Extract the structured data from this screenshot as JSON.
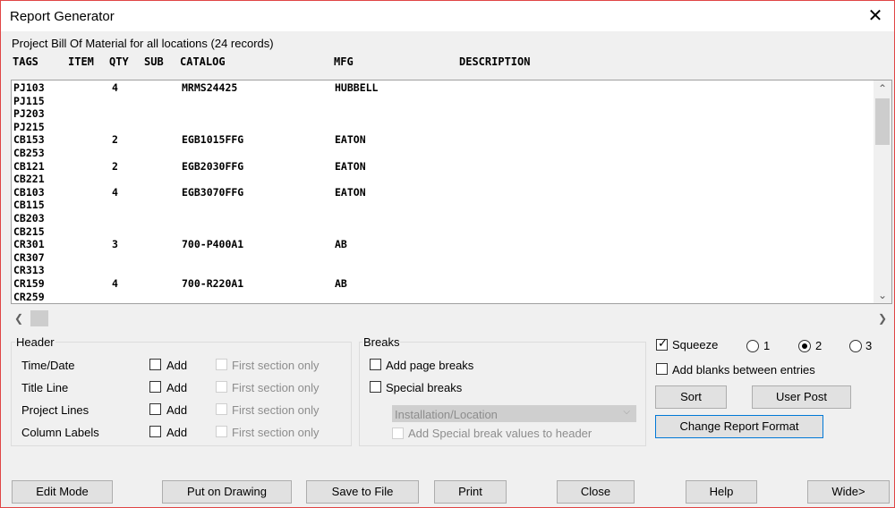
{
  "window": {
    "title": "Report Generator",
    "close_glyph": "✕"
  },
  "summary": "Project Bill Of Material for all locations (24 records)",
  "columns": [
    "TAGS",
    "ITEM",
    "QTY",
    "SUB",
    "CATALOG",
    "MFG",
    "DESCRIPTION"
  ],
  "rows": [
    {
      "tag": "PJ103",
      "qty": "4",
      "catalog": "MRMS24425",
      "mfg": "HUBBELL"
    },
    {
      "tag": "PJ115",
      "qty": "",
      "catalog": "",
      "mfg": ""
    },
    {
      "tag": "PJ203",
      "qty": "",
      "catalog": "",
      "mfg": ""
    },
    {
      "tag": "PJ215",
      "qty": "",
      "catalog": "",
      "mfg": ""
    },
    {
      "tag": "CB153",
      "qty": "2",
      "catalog": "EGB1015FFG",
      "mfg": "EATON"
    },
    {
      "tag": "CB253",
      "qty": "",
      "catalog": "",
      "mfg": ""
    },
    {
      "tag": "CB121",
      "qty": "2",
      "catalog": "EGB2030FFG",
      "mfg": "EATON"
    },
    {
      "tag": "CB221",
      "qty": "",
      "catalog": "",
      "mfg": ""
    },
    {
      "tag": "CB103",
      "qty": "4",
      "catalog": "EGB3070FFG",
      "mfg": "EATON"
    },
    {
      "tag": "CB115",
      "qty": "",
      "catalog": "",
      "mfg": ""
    },
    {
      "tag": "CB203",
      "qty": "",
      "catalog": "",
      "mfg": ""
    },
    {
      "tag": "CB215",
      "qty": "",
      "catalog": "",
      "mfg": ""
    },
    {
      "tag": "CR301",
      "qty": "3",
      "catalog": "700-P400A1",
      "mfg": "AB"
    },
    {
      "tag": "CR307",
      "qty": "",
      "catalog": "",
      "mfg": ""
    },
    {
      "tag": "CR313",
      "qty": "",
      "catalog": "",
      "mfg": ""
    },
    {
      "tag": "CR159",
      "qty": "4",
      "catalog": "700-R220A1",
      "mfg": "AB"
    },
    {
      "tag": "CR259",
      "qty": "",
      "catalog": "",
      "mfg": ""
    }
  ],
  "scroll_glyphs": {
    "up": "⌃",
    "down": "⌄",
    "left": "❮",
    "right": "❯"
  },
  "header_group": {
    "title": "Header",
    "rows": [
      {
        "label": "Time/Date",
        "add": "Add",
        "first": "First section only"
      },
      {
        "label": "Title Line",
        "add": "Add",
        "first": "First section only"
      },
      {
        "label": "Project Lines",
        "add": "Add",
        "first": "First section only"
      },
      {
        "label": "Column Labels",
        "add": "Add",
        "first": "First section only"
      }
    ]
  },
  "breaks_group": {
    "title": "Breaks",
    "page_breaks": "Add page breaks",
    "special_breaks": "Special breaks",
    "combo_value": "Installation/Location",
    "combo_arrow": "⌵",
    "add_special": "Add Special break values to header"
  },
  "options": {
    "squeeze": "Squeeze",
    "squeeze_checked": true,
    "check_glyph": "✓",
    "radios": [
      "1",
      "2",
      "3"
    ],
    "radio_selected": "2",
    "add_blanks": "Add blanks between entries"
  },
  "buttons": {
    "sort": "Sort",
    "user_post": "User Post",
    "change_format": "Change Report Format",
    "edit_mode": "Edit Mode",
    "put_on_drawing": "Put on Drawing",
    "save_to_file": "Save to File",
    "print": "Print",
    "close": "Close",
    "help": "Help",
    "wide": "Wide>"
  }
}
